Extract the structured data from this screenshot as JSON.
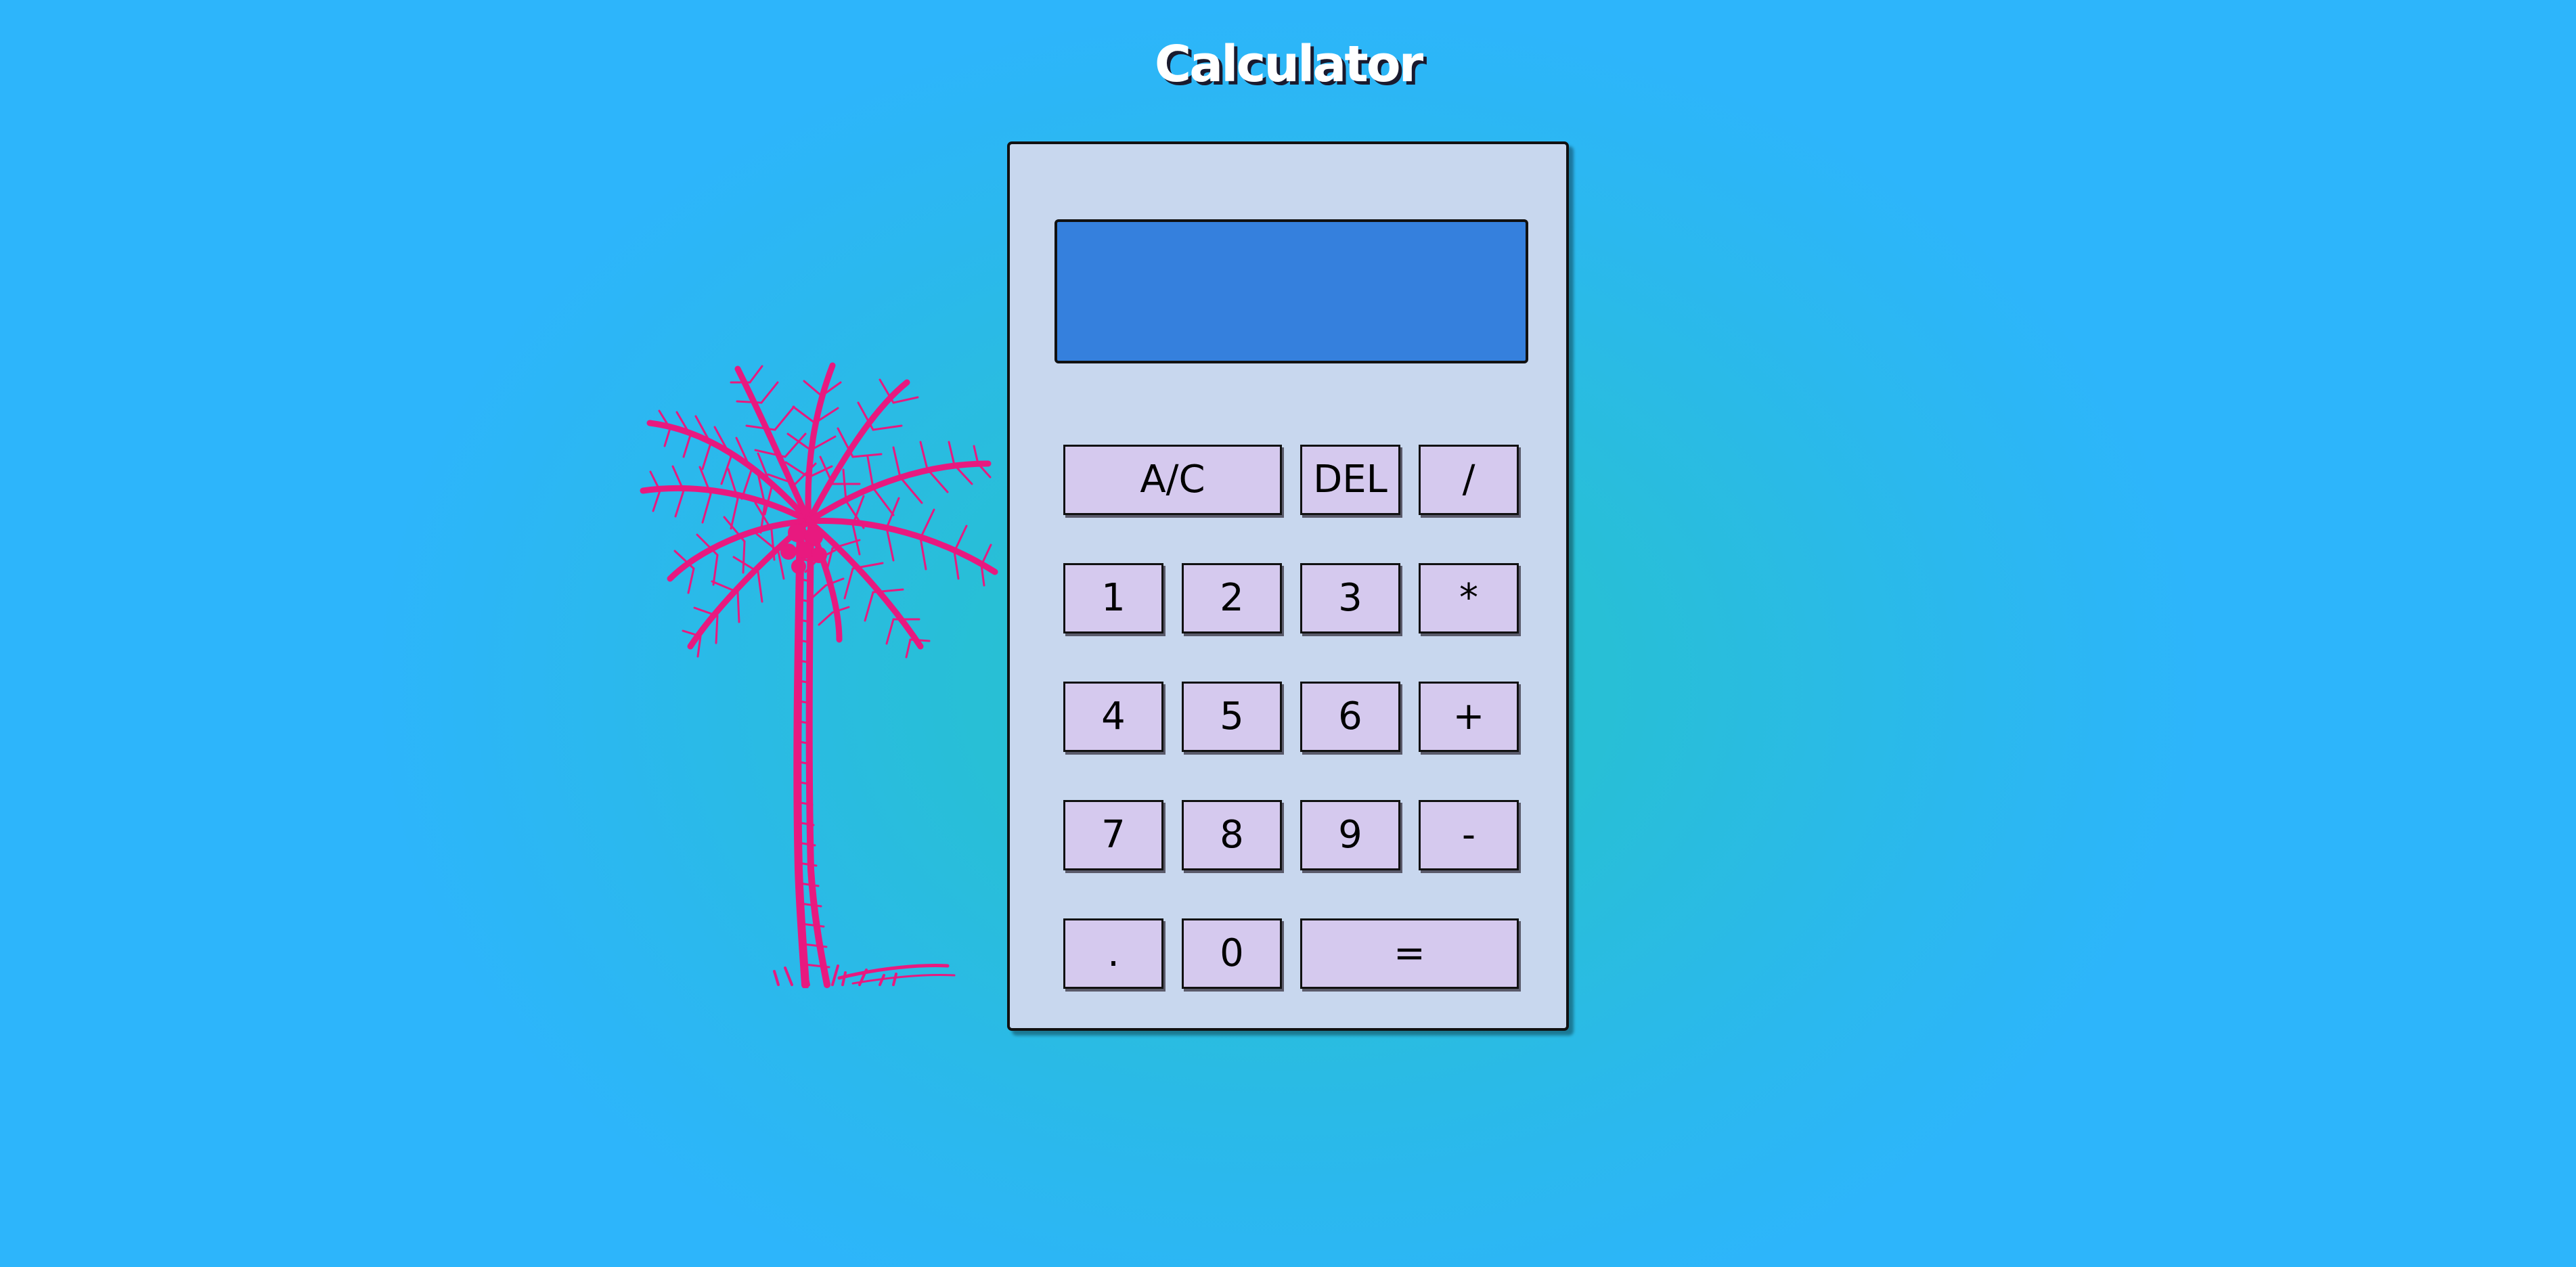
{
  "page": {
    "title": "Calculator"
  },
  "decoration": {
    "palm_icon": "palm-tree-icon",
    "palm_color": "#e8197f"
  },
  "calculator": {
    "display_value": "",
    "keys": {
      "clear": "A/C",
      "delete": "DEL",
      "divide": "/",
      "one": "1",
      "two": "2",
      "three": "3",
      "multiply": "*",
      "four": "4",
      "five": "5",
      "six": "6",
      "add": "+",
      "seven": "7",
      "eight": "8",
      "nine": "9",
      "subtract": "-",
      "decimal": ".",
      "zero": "0",
      "equals": "="
    }
  },
  "colors": {
    "background": "#2db5fb",
    "calculator_body": "#c8d7ee",
    "display": "#3580dd",
    "key": "#d5c9ee"
  }
}
